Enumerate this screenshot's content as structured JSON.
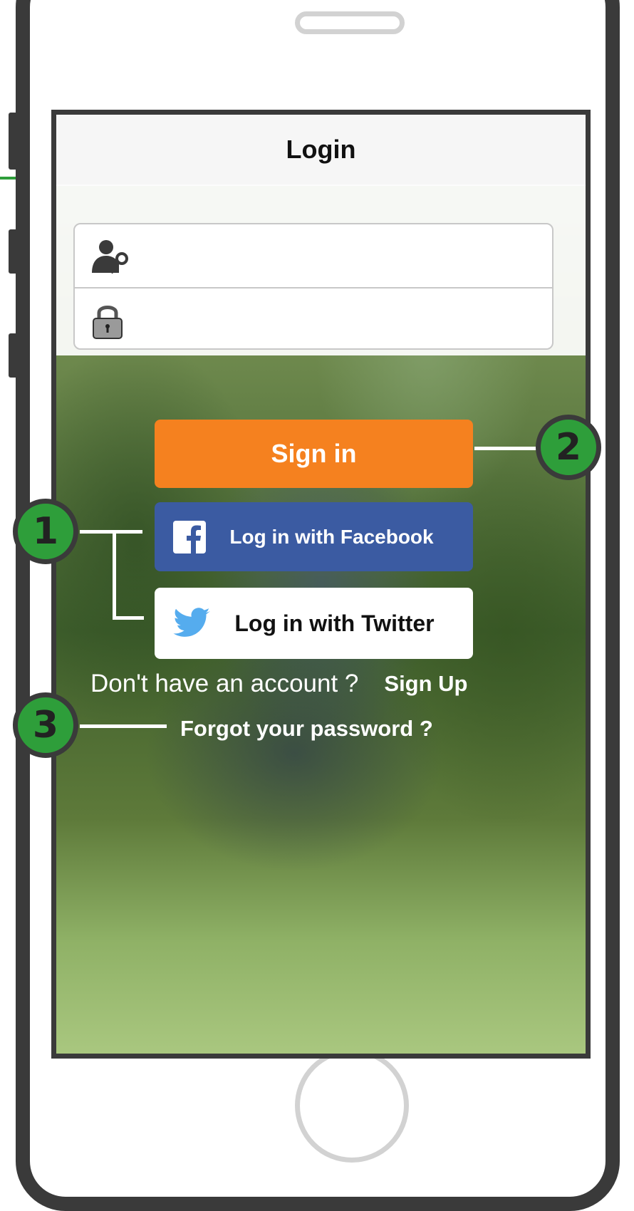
{
  "navbar": {
    "title": "Login"
  },
  "form": {
    "username_placeholder": "",
    "password_placeholder": ""
  },
  "buttons": {
    "signin_label": "Sign in",
    "facebook_label": "Log in with Facebook",
    "twitter_label": "Log in with Twitter"
  },
  "signup": {
    "question": "Don't have an account ?",
    "link": "Sign Up"
  },
  "forgot_label": "Forgot your password ?",
  "callouts": [
    "1",
    "2",
    "3"
  ],
  "colors": {
    "signin": "#f5811f",
    "facebook": "#3b5ba2",
    "twitter_bird": "#55acee",
    "callout": "#2e9e3a",
    "frame": "#3a3a3a"
  },
  "icons": {
    "username": "user-key-icon",
    "password": "padlock-icon",
    "facebook": "facebook-icon",
    "twitter": "twitter-bird-icon"
  }
}
